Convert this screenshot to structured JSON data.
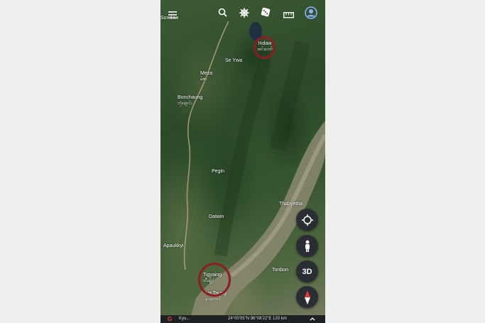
{
  "toolbar": {
    "menu_icon": "hamburger-icon",
    "search_icon": "search-icon",
    "voyager_icon": "ship-wheel-icon",
    "feeling_lucky_icon": "dice-icon",
    "measure_icon": "ruler-icon",
    "account_icon": "account-icon"
  },
  "map": {
    "labels": {
      "sondaw": "Sondaw",
      "indaw": "Indaw",
      "indaw_local": "အင်းတော်",
      "se_ywa": "Se Ywa",
      "meza": "Meza",
      "meza_local": "မဲဇာ",
      "bonchaung": "Bonchaung",
      "bonchaung_local": "ဘုံချောင်း",
      "pegin": "Pegin",
      "thabyetha": "Thabyetha",
      "datwin": "Datwin",
      "apaukkyi": "Apaukkyi",
      "tonbon": "Tonbon",
      "tigyaing": "Tigyaing",
      "tigyaing_local": "ထီးချိုင့်",
      "na_taung": "Na Taung",
      "na_taung_local": "နားတောင်"
    },
    "highlight_color": "#8e1d22"
  },
  "controls": {
    "locate_icon": "crosshair-icon",
    "street_view_icon": "pegman-icon",
    "three_d_label": "3D",
    "compass_icon": "compass-icon"
  },
  "bottom_bar": {
    "logo": "G",
    "attribution": "Kyu...",
    "coordinates": "24°00'05\"N 96°08'22\"E 120 km",
    "expand_icon": "chevron-up-icon"
  }
}
